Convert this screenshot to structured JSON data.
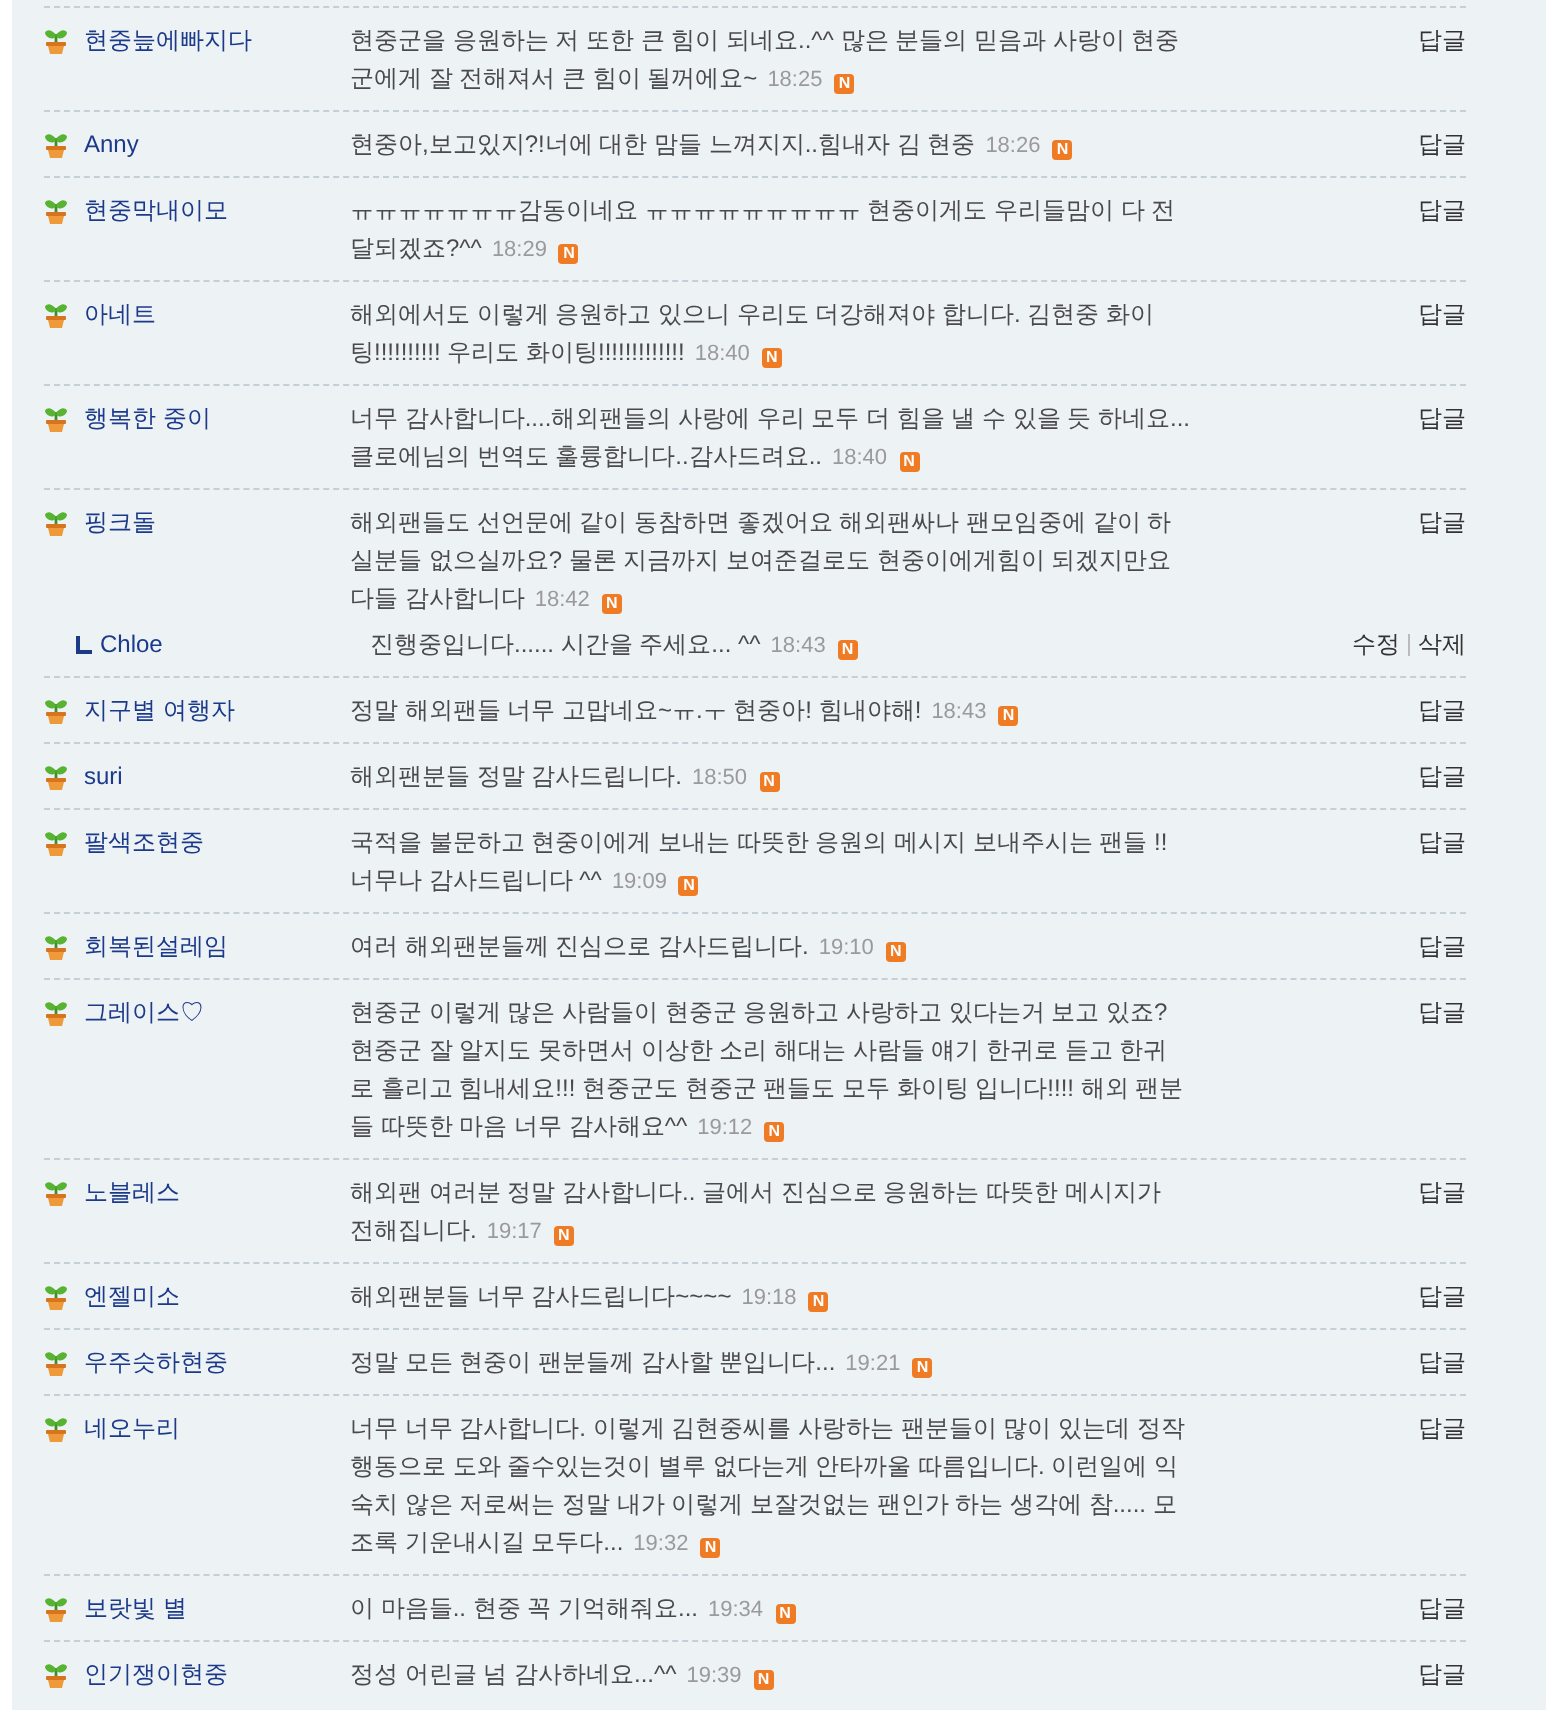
{
  "comments": [
    {
      "author": "현중늪에빠지다",
      "text": "현중군을 응원하는 저 또한 큰 힘이 되네요..^^ 많은 분들의 믿음과 사랑이 현중군에게 잘 전해져서 큰 힘이 될꺼에요~",
      "time": "18:25",
      "new_badge": "N",
      "actions": [
        "답글"
      ]
    },
    {
      "author": "Anny",
      "text": "현중아,보고있지?!너에 대한 맘들 느껴지지..힘내자 김 현중",
      "time": "18:26",
      "new_badge": "N",
      "actions": [
        "답글"
      ]
    },
    {
      "author": "현중막내이모",
      "text": "ㅠㅠㅠㅠㅠㅠㅠ감동이네요 ㅠㅠㅠㅠㅠㅠㅠㅠㅠ 현중이게도 우리들맘이 다 전달되겠죠?^^",
      "time": "18:29",
      "new_badge": "N",
      "actions": [
        "답글"
      ]
    },
    {
      "author": "아네트",
      "text": "해외에서도 이렇게 응원하고 있으니 우리도 더강해져야 합니다. 김현중 화이팅!!!!!!!!!! 우리도 화이팅!!!!!!!!!!!!!",
      "time": "18:40",
      "new_badge": "N",
      "actions": [
        "답글"
      ]
    },
    {
      "author": "행복한 중이",
      "text": "너무 감사합니다....해외팬들의 사랑에 우리 모두 더 힘을 낼 수 있을 듯 하네요...클로에님의 번역도 훌륭합니다..감사드려요..",
      "time": "18:40",
      "new_badge": "N",
      "actions": [
        "답글"
      ]
    },
    {
      "author": "핑크돌",
      "text": "해외팬들도 선언문에 같이 동참하면 좋겠어요 해외팬싸나 팬모임중에 같이 하실분들 없으실까요? 물론 지금까지 보여준걸로도 현중이에게힘이 되겠지만요 다들 감사합니다",
      "time": "18:42",
      "new_badge": "N",
      "actions": [
        "답글"
      ],
      "replies": [
        {
          "author": "Chloe",
          "text": "진행중입니다...... 시간을 주세요... ^^",
          "time": "18:43",
          "new_badge": "N",
          "actions": [
            "수정",
            "삭제"
          ]
        }
      ]
    },
    {
      "author": "지구별 여행자",
      "text": "정말 해외팬들 너무 고맙네요~ㅠ.ㅜ 현중아! 힘내야해!",
      "time": "18:43",
      "new_badge": "N",
      "actions": [
        "답글"
      ]
    },
    {
      "author": "suri",
      "text": "해외팬분들 정말 감사드립니다.",
      "time": "18:50",
      "new_badge": "N",
      "actions": [
        "답글"
      ]
    },
    {
      "author": "팔색조현중",
      "text": "국적을 불문하고 현중이에게 보내는 따뜻한 응원의 메시지 보내주시는 팬들 !! 너무나 감사드립니다 ^^",
      "time": "19:09",
      "new_badge": "N",
      "actions": [
        "답글"
      ]
    },
    {
      "author": "회복된설레임",
      "text": "여러 해외팬분들께 진심으로 감사드립니다.",
      "time": "19:10",
      "new_badge": "N",
      "actions": [
        "답글"
      ]
    },
    {
      "author": "그레이스♡",
      "text": "현중군 이렇게 많은 사람들이 현중군 응원하고 사랑하고 있다는거 보고 있죠? 현중군 잘 알지도 못하면서 이상한 소리 해대는 사람들 얘기 한귀로 듣고 한귀로 흘리고 힘내세요!!! 현중군도 현중군 팬들도 모두 화이팅 입니다!!!! 해외 팬분들 따뜻한 마음 너무 감사해요^^",
      "time": "19:12",
      "new_badge": "N",
      "actions": [
        "답글"
      ]
    },
    {
      "author": "노블레스",
      "text": "해외팬 여러분 정말 감사합니다.. 글에서 진심으로 응원하는 따뜻한 메시지가 전해집니다.",
      "time": "19:17",
      "new_badge": "N",
      "actions": [
        "답글"
      ]
    },
    {
      "author": "엔젤미소",
      "text": "해외팬분들 너무 감사드립니다~~~~",
      "time": "19:18",
      "new_badge": "N",
      "actions": [
        "답글"
      ]
    },
    {
      "author": "우주슷하현중",
      "text": "정말 모든 현중이 팬분들께 감사할 뿐입니다...",
      "time": "19:21",
      "new_badge": "N",
      "actions": [
        "답글"
      ]
    },
    {
      "author": "네오누리",
      "text": "너무 너무 감사합니다. 이렇게 김현중씨를 사랑하는 팬분들이 많이 있는데 정작 행동으로 도와 줄수있는것이 별루 없다는게 안타까울 따름입니다. 이런일에 익숙치 않은 저로써는 정말 내가 이렇게 보잘것없는 팬인가 하는 생각에 참..... 모조록 기운내시길 모두다...",
      "time": "19:32",
      "new_badge": "N",
      "actions": [
        "답글"
      ]
    },
    {
      "author": "보랏빛 별",
      "text": "이 마음들.. 현중 꼭 기억해줘요...",
      "time": "19:34",
      "new_badge": "N",
      "actions": [
        "답글"
      ]
    },
    {
      "author": "인기쟁이현중",
      "text": "정성 어린글 넘 감사하네요...^^",
      "time": "19:39",
      "new_badge": "N",
      "actions": [
        "답글"
      ]
    }
  ]
}
